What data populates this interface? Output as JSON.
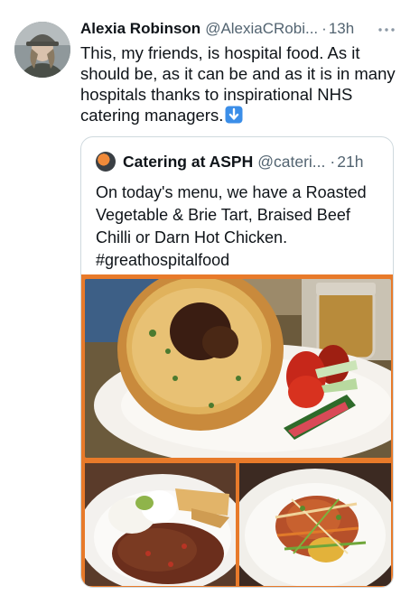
{
  "tweet": {
    "author_name": "Alexia Robinson",
    "author_handle": "@AlexiaCRobi...",
    "separator": "·",
    "time": "13h",
    "text": "This, my friends, is hospital food. As it should be, as it can be and as it is in many hospitals thanks to inspirational NHS catering managers.",
    "more_icon": "ellipsis-icon",
    "emoji_icon": "down-arrow-icon"
  },
  "quoted_tweet": {
    "author_name": "Catering at ASPH",
    "author_handle": "@cateri...",
    "separator": "·",
    "time": "21h",
    "text": "On today's menu, we have a Roasted Vegetable & Brie Tart, Braised Beef Chilli or Darn Hot Chicken. #greathospitalfood"
  },
  "colors": {
    "text_primary": "#0f1419",
    "text_secondary": "#536471",
    "border": "#cfd9de",
    "media_border": "#e87a2a",
    "emoji_blue": "#3b8ee8"
  }
}
